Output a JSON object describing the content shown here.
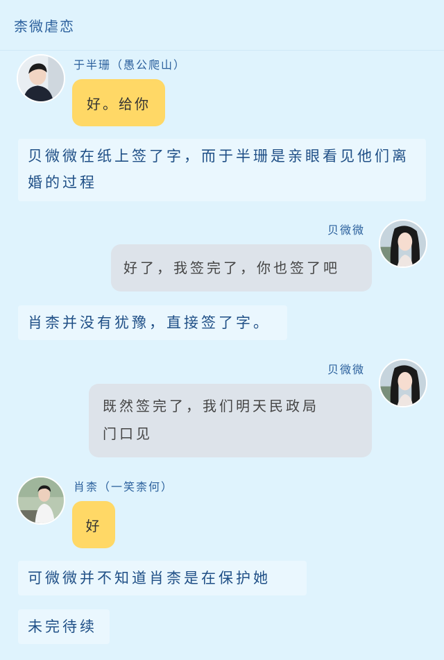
{
  "header": {
    "title": "柰微虐恋"
  },
  "messages": [
    {
      "speaker": "于半珊（愚公爬山）",
      "side": "left",
      "text": "好。给你"
    },
    {
      "narration": "贝微微在纸上签了字，而于半珊是亲眼看见他们离婚的过程"
    },
    {
      "speaker": "贝微微",
      "side": "right",
      "text": "好了，我签完了，你也签了吧"
    },
    {
      "narration": "肖柰并没有犹豫，直接签了字。"
    },
    {
      "speaker": "贝微微",
      "side": "right",
      "text_line1": "既然签完了，我们明天民政局",
      "text_line2": "门口见"
    },
    {
      "speaker": "肖柰（一笑柰何）",
      "side": "left",
      "text": "好"
    },
    {
      "narration": "可微微并不知道肖柰是在保护她"
    },
    {
      "narration": "未完待续"
    }
  ],
  "colors": {
    "background": "#dff3fd",
    "left_bubble": "#ffd866",
    "right_bubble": "#dde3ea",
    "narration_bg": "#eaf7fe",
    "name_text": "#2a5f9c"
  }
}
